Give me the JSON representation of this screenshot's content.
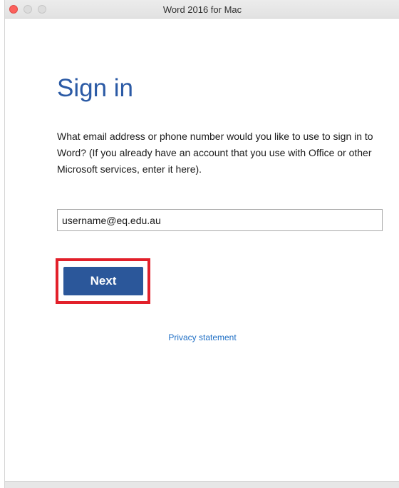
{
  "window": {
    "title": "Word 2016 for Mac",
    "controls": {
      "close_color": "#fc605c",
      "minimize_color": "#dcdcdc",
      "zoom_color": "#dcdcdc"
    }
  },
  "signin": {
    "heading": "Sign in",
    "instructions": "What email address or phone number would you like to use to sign in to Word? (If you already have an account that you use with Office or other Microsoft services, enter it here).",
    "email_value": "username@eq.edu.au",
    "next_label": "Next",
    "privacy_label": "Privacy statement"
  },
  "colors": {
    "heading": "#2b5aa5",
    "button": "#2b579a",
    "link": "#1f6fc5",
    "highlight": "#e2202a"
  }
}
